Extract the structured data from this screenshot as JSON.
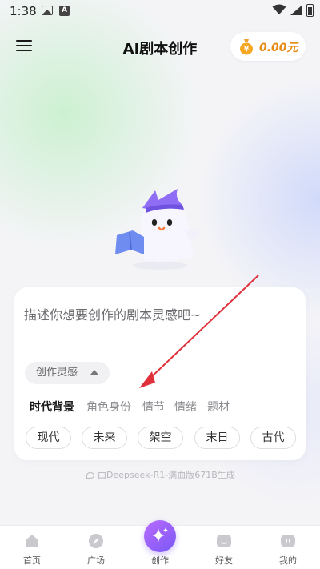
{
  "status_bar": {
    "time": "1:38"
  },
  "header": {
    "title": "AI剧本创作",
    "balance": "0.00元"
  },
  "prompt": {
    "placeholder": "描述你想要创作的剧本灵感吧~"
  },
  "inspiration": {
    "toggle_label": "创作灵感",
    "tabs": [
      "时代背景",
      "角色身份",
      "情节",
      "情绪",
      "题材"
    ],
    "active_tab": "时代背景",
    "chips": [
      "现代",
      "未来",
      "架空",
      "末日",
      "古代"
    ]
  },
  "footnote": "由Deepseek-R1-满血版671B生成",
  "nav": {
    "items": [
      {
        "label": "首页",
        "icon": "home-icon"
      },
      {
        "label": "广场",
        "icon": "plaza-icon"
      },
      {
        "label": "创作",
        "icon": "sparkle-icon"
      },
      {
        "label": "好友",
        "icon": "friends-icon"
      },
      {
        "label": "我的",
        "icon": "profile-icon"
      }
    ],
    "active": "创作"
  },
  "colors": {
    "accent_orange": "#e58a15",
    "create_purple": "#8a5cf6",
    "arrow_red": "#e0303a"
  }
}
